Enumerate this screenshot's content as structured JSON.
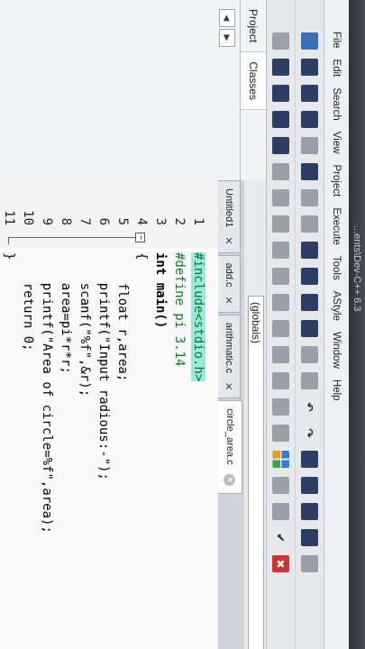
{
  "window": {
    "title": "...ents\\Dev-C++ 6.3"
  },
  "menu": [
    "File",
    "Edit",
    "Search",
    "View",
    "Project",
    "Execute",
    "Tools",
    "AStyle",
    "Window",
    "Help"
  ],
  "left_panel": {
    "tabs": [
      "Project",
      "Classes"
    ],
    "active_tab": "Classes"
  },
  "scope_selector": {
    "value": "(globals)"
  },
  "editor_tabs": [
    {
      "label": "Untitled1",
      "active": false
    },
    {
      "label": "add.c",
      "active": false
    },
    {
      "label": "arithmatic.c",
      "active": false
    },
    {
      "label": "circle_area.c",
      "active": true
    }
  ],
  "code": {
    "line_numbers": [
      "1",
      "2",
      "3",
      "4",
      "5",
      "6",
      "7",
      "8",
      "9",
      "10",
      "11"
    ],
    "lines": [
      "#include<stdio.h>",
      "#define pi 3.14",
      "int main()",
      "{",
      "    float r,area;",
      "    printf(\"Input radious:-\");",
      "    scanf(\"%f\",&r);",
      "    area=pi*r*r;",
      "    printf(\"Area of circle=%f\",area);",
      "    return 0;",
      "}"
    ],
    "highlighted_line": 1
  },
  "colors": {
    "current_line": "#9fe6df",
    "preprocessor": "#0a7a2a",
    "string": "#1c3fc2",
    "number": "#8a2be2",
    "operator": "#c0162e"
  }
}
